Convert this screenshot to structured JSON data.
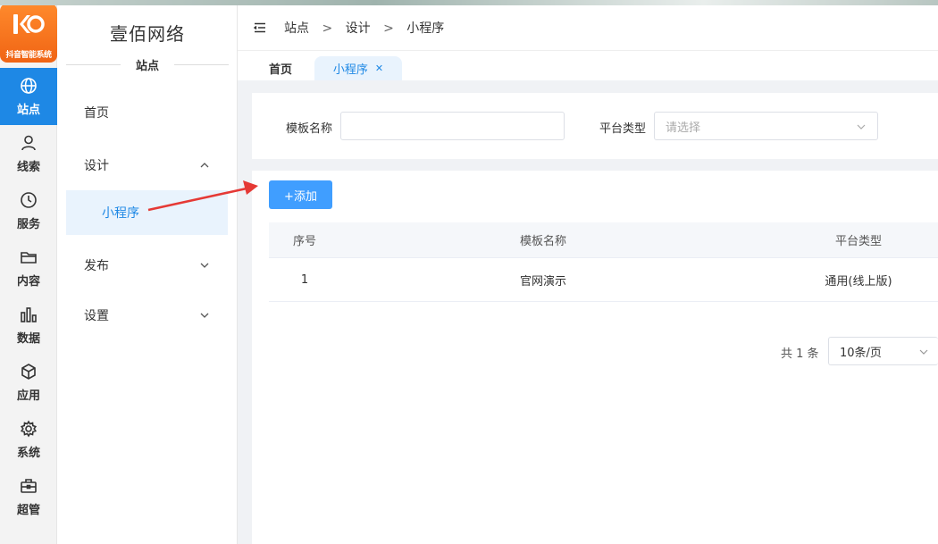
{
  "logo": {
    "text": "抖音智能系统"
  },
  "rail": {
    "items": [
      {
        "label": "站点",
        "icon": "globe-icon",
        "active": true
      },
      {
        "label": "线索",
        "icon": "user-icon"
      },
      {
        "label": "服务",
        "icon": "clock-icon"
      },
      {
        "label": "内容",
        "icon": "folder-icon"
      },
      {
        "label": "数据",
        "icon": "bar-chart-icon"
      },
      {
        "label": "应用",
        "icon": "cube-icon"
      },
      {
        "label": "系统",
        "icon": "gear-icon"
      },
      {
        "label": "超管",
        "icon": "briefcase-icon"
      }
    ]
  },
  "sidebar": {
    "brand": "壹佰网络",
    "section": "站点",
    "items": [
      {
        "label": "首页"
      },
      {
        "label": "设计",
        "expanded": true,
        "children": [
          {
            "label": "小程序",
            "active": true
          }
        ]
      },
      {
        "label": "发布"
      },
      {
        "label": "设置"
      }
    ]
  },
  "breadcrumb": [
    "站点",
    "设计",
    "小程序"
  ],
  "breadcrumb_sep": ">",
  "tabs": [
    {
      "label": "首页"
    },
    {
      "label": "小程序",
      "active": true,
      "closable": true
    }
  ],
  "search": {
    "template_name_label": "模板名称",
    "template_name_value": "",
    "platform_label": "平台类型",
    "platform_placeholder": "请选择"
  },
  "toolbar": {
    "add_label": "+添加"
  },
  "table": {
    "columns": [
      "序号",
      "模板名称",
      "平台类型"
    ],
    "rows": [
      {
        "index": "1",
        "name": "官网演示",
        "platform": "通用(线上版)"
      }
    ]
  },
  "pager": {
    "total": "共 1 条",
    "page_size": "10条/页"
  },
  "colors": {
    "primary": "#409eff",
    "rail_active": "#1e88e5",
    "annotation": "#e53935"
  }
}
